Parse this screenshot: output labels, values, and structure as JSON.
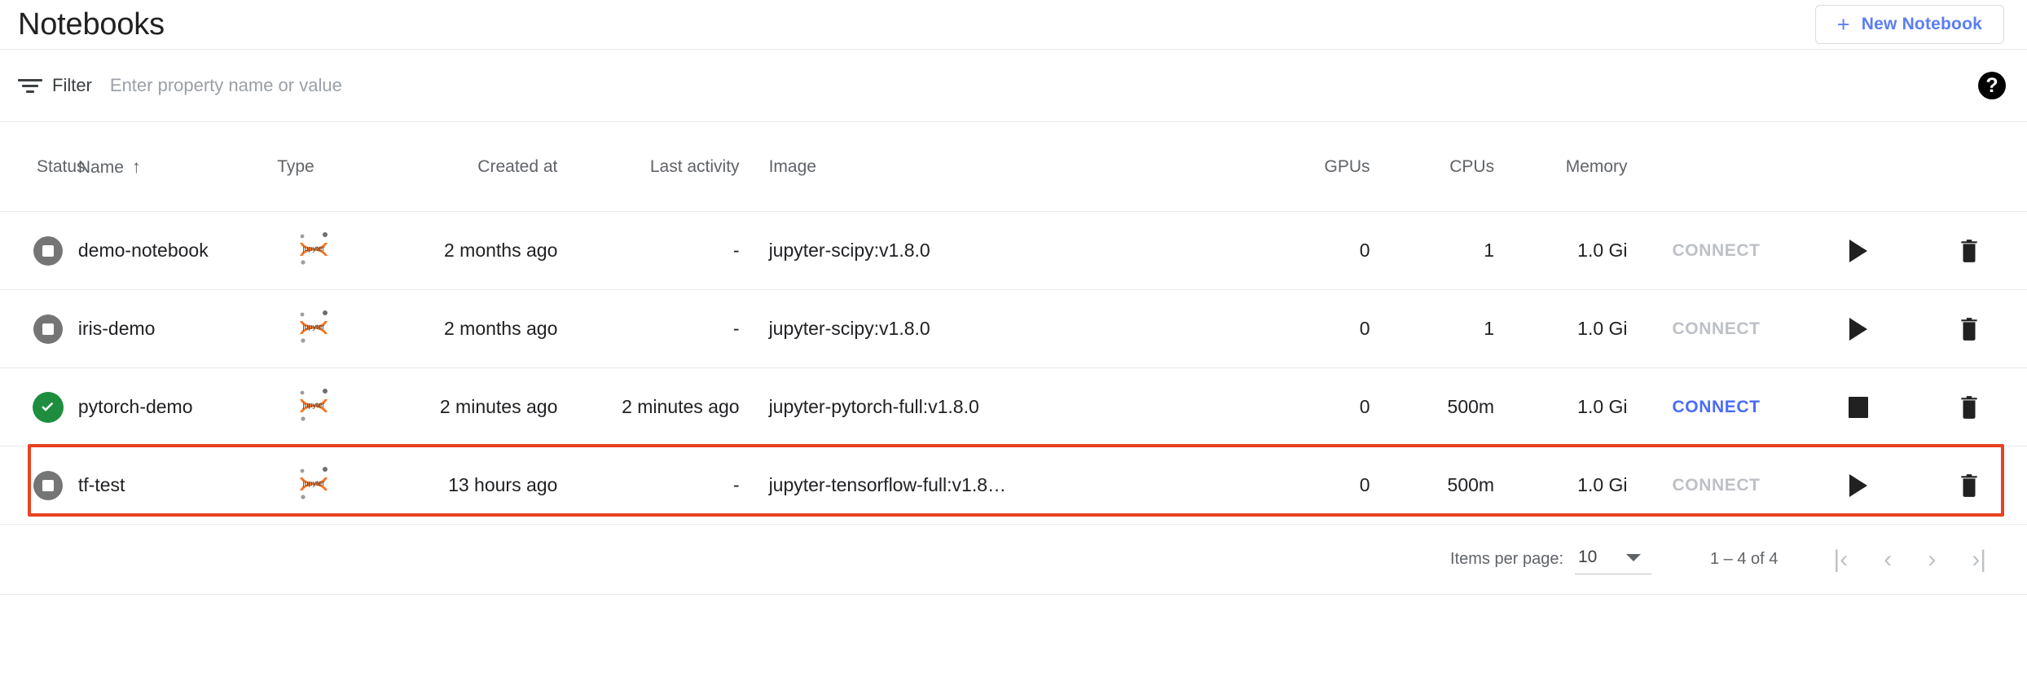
{
  "header": {
    "title": "Notebooks",
    "new_button": {
      "label": "New Notebook",
      "icon": "plus-icon",
      "color": "#5b7ef5"
    }
  },
  "filter": {
    "icon": "filter-icon",
    "label": "Filter",
    "placeholder": "Enter property name or value",
    "value": "",
    "help_icon": "help-icon",
    "help_glyph": "?"
  },
  "table": {
    "columns": [
      {
        "key": "status",
        "label": "Status"
      },
      {
        "key": "name",
        "label": "Name",
        "sorted": "asc",
        "sort_glyph": "↑"
      },
      {
        "key": "type",
        "label": "Type"
      },
      {
        "key": "created",
        "label": "Created at"
      },
      {
        "key": "last",
        "label": "Last activity"
      },
      {
        "key": "image",
        "label": "Image"
      },
      {
        "key": "gpus",
        "label": "GPUs"
      },
      {
        "key": "cpus",
        "label": "CPUs"
      },
      {
        "key": "memory",
        "label": "Memory"
      },
      {
        "key": "connect",
        "label": ""
      },
      {
        "key": "run",
        "label": ""
      },
      {
        "key": "delete",
        "label": ""
      }
    ],
    "rows": [
      {
        "status": "stopped",
        "status_icon": "stopped-icon",
        "name": "demo-notebook",
        "type_icon": "jupyter-icon",
        "created": "2 months ago",
        "last": "-",
        "image": "jupyter-scipy:v1.8.0",
        "gpus": "0",
        "cpus": "1",
        "memory": "1.0 Gi",
        "connect": "CONNECT",
        "connect_enabled": false,
        "action_icon": "play-icon",
        "delete_icon": "trash-icon",
        "highlighted": false
      },
      {
        "status": "stopped",
        "status_icon": "stopped-icon",
        "name": "iris-demo",
        "type_icon": "jupyter-icon",
        "created": "2 months ago",
        "last": "-",
        "image": "jupyter-scipy:v1.8.0",
        "gpus": "0",
        "cpus": "1",
        "memory": "1.0 Gi",
        "connect": "CONNECT",
        "connect_enabled": false,
        "action_icon": "play-icon",
        "delete_icon": "trash-icon",
        "highlighted": false
      },
      {
        "status": "ready",
        "status_icon": "check-circle-icon",
        "name": "pytorch-demo",
        "type_icon": "jupyter-icon",
        "created": "2 minutes ago",
        "last": "2 minutes ago",
        "image": "jupyter-pytorch-full:v1.8.0",
        "gpus": "0",
        "cpus": "500m",
        "memory": "1.0 Gi",
        "connect": "CONNECT",
        "connect_enabled": true,
        "action_icon": "stop-icon",
        "delete_icon": "trash-icon",
        "highlighted": true
      },
      {
        "status": "stopped",
        "status_icon": "stopped-icon",
        "name": "tf-test",
        "type_icon": "jupyter-icon",
        "created": "13 hours ago",
        "last": "-",
        "image": "jupyter-tensorflow-full:v1.8…",
        "gpus": "0",
        "cpus": "500m",
        "memory": "1.0 Gi",
        "connect": "CONNECT",
        "connect_enabled": false,
        "action_icon": "play-icon",
        "delete_icon": "trash-icon",
        "highlighted": false
      }
    ]
  },
  "paginator": {
    "items_per_page_label": "Items per page:",
    "items_per_page_value": "10",
    "range_label": "1 – 4 of 4",
    "first_glyph": "|‹",
    "prev_glyph": "‹",
    "next_glyph": "›",
    "last_glyph": "›|"
  },
  "colors": {
    "accent_blue": "#4a6cf7",
    "highlight_red": "#e8431f",
    "status_ready_green": "#1e8e3e",
    "status_stopped_gray": "#757575",
    "jupyter_orange": "#f37726"
  }
}
